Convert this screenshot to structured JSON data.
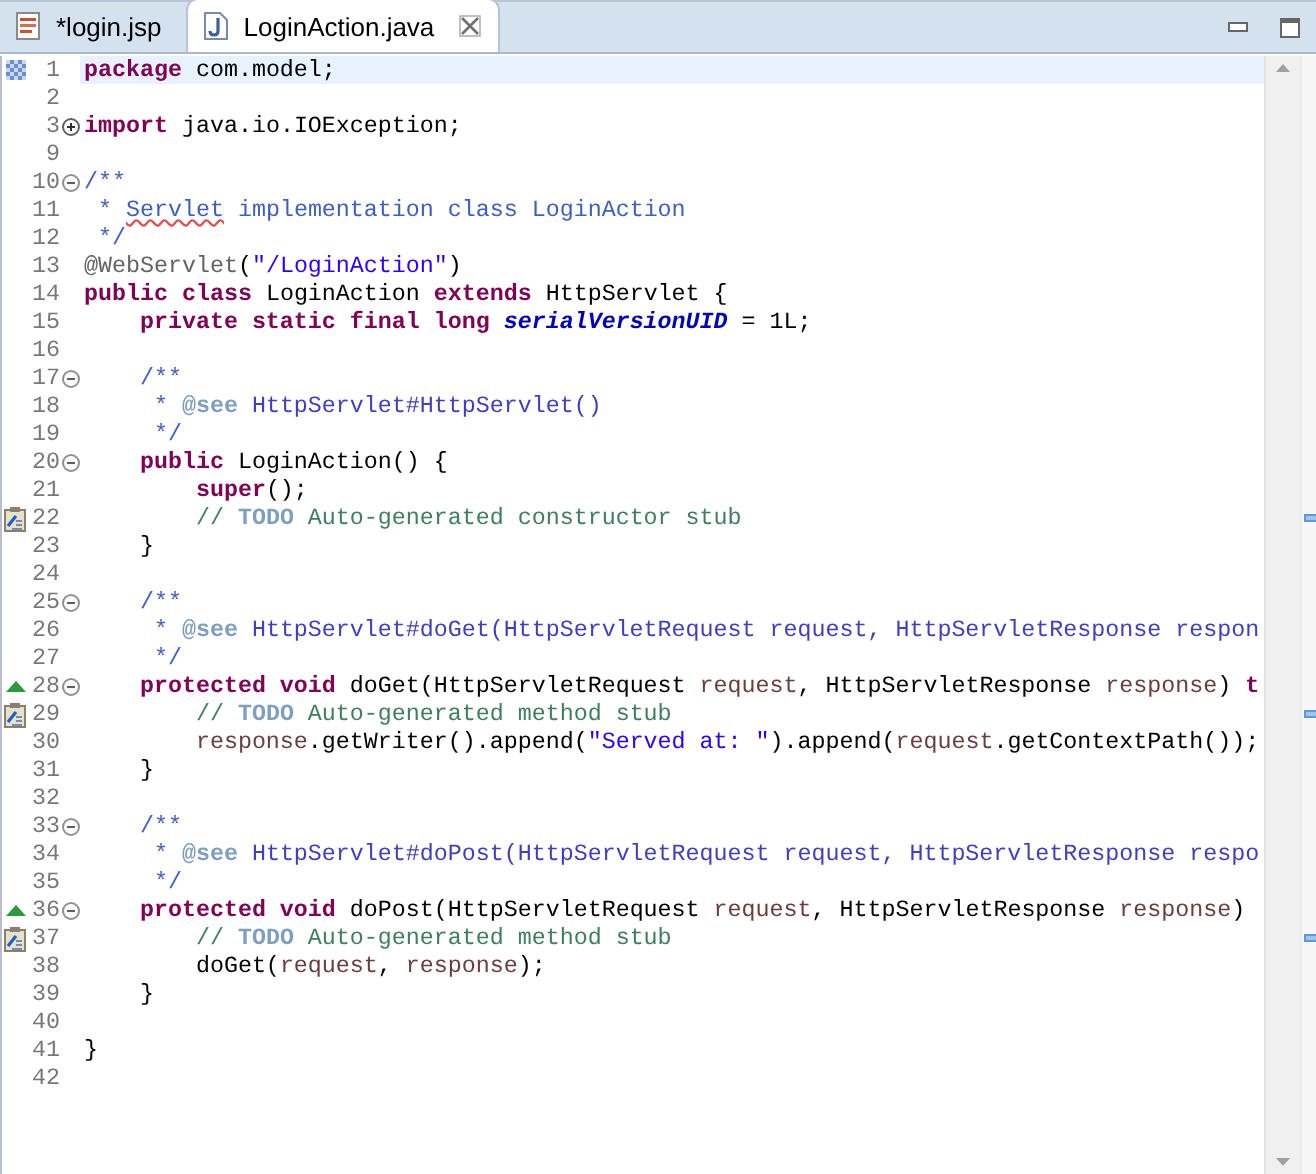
{
  "tabs": [
    {
      "label": "*login.jsp",
      "kind": "jsp",
      "selected": false
    },
    {
      "label": "LoginAction.java",
      "kind": "java",
      "selected": true
    }
  ],
  "editor": {
    "lines": [
      {
        "number": "1",
        "current": true,
        "marker": {
          "kind": "range"
        },
        "tokens": [
          {
            "kind": "keyword",
            "text": "package"
          },
          {
            "kind": "plain",
            "text": " com.model;"
          }
        ]
      },
      {
        "number": "2",
        "current": false
      },
      {
        "number": "3",
        "current": false,
        "fold": {
          "expanded": false
        },
        "tokens": [
          {
            "kind": "keyword",
            "text": "import"
          },
          {
            "kind": "plain",
            "text": " java.io.IOException;"
          }
        ]
      },
      {
        "number": "9",
        "current": false
      },
      {
        "number": "10",
        "current": false,
        "fold": {
          "expanded": true
        },
        "tokens": [
          {
            "kind": "javadoc",
            "text": "/**"
          }
        ]
      },
      {
        "number": "11",
        "current": false,
        "tokens": [
          {
            "kind": "javadoc",
            "text": " * "
          },
          {
            "kind": "misspelled",
            "text": "Servlet"
          },
          {
            "kind": "javadoc",
            "text": " implementation class LoginAction"
          }
        ]
      },
      {
        "number": "12",
        "current": false,
        "tokens": [
          {
            "kind": "javadoc",
            "text": " */"
          }
        ]
      },
      {
        "number": "13",
        "current": false,
        "tokens": [
          {
            "kind": "annotation",
            "text": "@WebServlet"
          },
          {
            "kind": "plain",
            "text": "("
          },
          {
            "kind": "string",
            "text": "\"/LoginAction\""
          },
          {
            "kind": "plain",
            "text": ")"
          }
        ]
      },
      {
        "number": "14",
        "current": false,
        "tokens": [
          {
            "kind": "keyword",
            "text": "public class"
          },
          {
            "kind": "plain",
            "text": " LoginAction "
          },
          {
            "kind": "keyword",
            "text": "extends"
          },
          {
            "kind": "plain",
            "text": " HttpServlet {"
          }
        ]
      },
      {
        "number": "15",
        "current": false,
        "tokens": [
          {
            "kind": "keyword",
            "text": "    private static final long "
          },
          {
            "kind": "field",
            "text": "serialVersionUID"
          },
          {
            "kind": "plain",
            "text": " = 1L;"
          }
        ]
      },
      {
        "number": "16",
        "current": false
      },
      {
        "number": "17",
        "current": false,
        "fold": {
          "expanded": true
        },
        "tokens": [
          {
            "kind": "javadoc",
            "text": "    /**"
          }
        ]
      },
      {
        "number": "18",
        "current": false,
        "tokens": [
          {
            "kind": "javadoc",
            "text": "     * "
          },
          {
            "kind": "tag",
            "text": "@see"
          },
          {
            "kind": "link",
            "text": " HttpServlet#HttpServlet()"
          }
        ]
      },
      {
        "number": "19",
        "current": false,
        "tokens": [
          {
            "kind": "javadoc",
            "text": "     */"
          }
        ]
      },
      {
        "number": "20",
        "current": false,
        "fold": {
          "expanded": true
        },
        "tokens": [
          {
            "kind": "keyword",
            "text": "    public"
          },
          {
            "kind": "plain",
            "text": " LoginAction() {"
          }
        ]
      },
      {
        "number": "21",
        "current": false,
        "tokens": [
          {
            "kind": "keyword",
            "text": "        super"
          },
          {
            "kind": "plain",
            "text": "();"
          }
        ]
      },
      {
        "number": "22",
        "current": false,
        "marker": {
          "kind": "task"
        },
        "tokens": [
          {
            "kind": "comment",
            "text": "        // "
          },
          {
            "kind": "tag",
            "text": "TODO"
          },
          {
            "kind": "comment",
            "text": " Auto-generated constructor stub"
          }
        ]
      },
      {
        "number": "23",
        "current": false,
        "tokens": [
          {
            "kind": "plain",
            "text": "    }"
          }
        ]
      },
      {
        "number": "24",
        "current": false
      },
      {
        "number": "25",
        "current": false,
        "fold": {
          "expanded": true
        },
        "tokens": [
          {
            "kind": "javadoc",
            "text": "    /**"
          }
        ]
      },
      {
        "number": "26",
        "current": false,
        "tokens": [
          {
            "kind": "javadoc",
            "text": "     * "
          },
          {
            "kind": "tag",
            "text": "@see"
          },
          {
            "kind": "link",
            "text": " HttpServlet#doGet(HttpServletRequest request, HttpServletResponse respon"
          }
        ]
      },
      {
        "number": "27",
        "current": false,
        "tokens": [
          {
            "kind": "javadoc",
            "text": "     */"
          }
        ]
      },
      {
        "number": "28",
        "current": false,
        "marker": {
          "kind": "override"
        },
        "fold": {
          "expanded": true
        },
        "tokens": [
          {
            "kind": "keyword",
            "text": "    protected void"
          },
          {
            "kind": "plain",
            "text": " doGet(HttpServletRequest "
          },
          {
            "kind": "variable",
            "text": "request"
          },
          {
            "kind": "plain",
            "text": ", HttpServletResponse "
          },
          {
            "kind": "variable",
            "text": "response"
          },
          {
            "kind": "plain",
            "text": ") "
          },
          {
            "kind": "keyword",
            "text": "t"
          }
        ]
      },
      {
        "number": "29",
        "current": false,
        "marker": {
          "kind": "task"
        },
        "tokens": [
          {
            "kind": "comment",
            "text": "        // "
          },
          {
            "kind": "tag",
            "text": "TODO"
          },
          {
            "kind": "comment",
            "text": " Auto-generated method stub"
          }
        ]
      },
      {
        "number": "30",
        "current": false,
        "tokens": [
          {
            "kind": "variable",
            "text": "        response"
          },
          {
            "kind": "plain",
            "text": ".getWriter().append("
          },
          {
            "kind": "string",
            "text": "\"Served at: \""
          },
          {
            "kind": "plain",
            "text": ").append("
          },
          {
            "kind": "variable",
            "text": "request"
          },
          {
            "kind": "plain",
            "text": ".getContextPath());"
          }
        ]
      },
      {
        "number": "31",
        "current": false,
        "tokens": [
          {
            "kind": "plain",
            "text": "    }"
          }
        ]
      },
      {
        "number": "32",
        "current": false
      },
      {
        "number": "33",
        "current": false,
        "fold": {
          "expanded": true
        },
        "tokens": [
          {
            "kind": "javadoc",
            "text": "    /**"
          }
        ]
      },
      {
        "number": "34",
        "current": false,
        "tokens": [
          {
            "kind": "javadoc",
            "text": "     * "
          },
          {
            "kind": "tag",
            "text": "@see"
          },
          {
            "kind": "link",
            "text": " HttpServlet#doPost(HttpServletRequest request, HttpServletResponse respo"
          }
        ]
      },
      {
        "number": "35",
        "current": false,
        "tokens": [
          {
            "kind": "javadoc",
            "text": "     */"
          }
        ]
      },
      {
        "number": "36",
        "current": false,
        "marker": {
          "kind": "override"
        },
        "fold": {
          "expanded": true
        },
        "tokens": [
          {
            "kind": "keyword",
            "text": "    protected void"
          },
          {
            "kind": "plain",
            "text": " doPost(HttpServletRequest "
          },
          {
            "kind": "variable",
            "text": "request"
          },
          {
            "kind": "plain",
            "text": ", HttpServletResponse "
          },
          {
            "kind": "variable",
            "text": "response"
          },
          {
            "kind": "plain",
            "text": ")"
          }
        ]
      },
      {
        "number": "37",
        "current": false,
        "marker": {
          "kind": "task"
        },
        "tokens": [
          {
            "kind": "comment",
            "text": "        // "
          },
          {
            "kind": "tag",
            "text": "TODO"
          },
          {
            "kind": "comment",
            "text": " Auto-generated method stub"
          }
        ]
      },
      {
        "number": "38",
        "current": false,
        "tokens": [
          {
            "kind": "plain",
            "text": "        doGet("
          },
          {
            "kind": "variable",
            "text": "request"
          },
          {
            "kind": "plain",
            "text": ", "
          },
          {
            "kind": "variable",
            "text": "response"
          },
          {
            "kind": "plain",
            "text": ");"
          }
        ]
      },
      {
        "number": "39",
        "current": false,
        "tokens": [
          {
            "kind": "plain",
            "text": "    }"
          }
        ]
      },
      {
        "number": "40",
        "current": false
      },
      {
        "number": "41",
        "current": false,
        "tokens": [
          {
            "kind": "plain",
            "text": "}"
          }
        ]
      },
      {
        "number": "42",
        "current": false
      }
    ]
  }
}
